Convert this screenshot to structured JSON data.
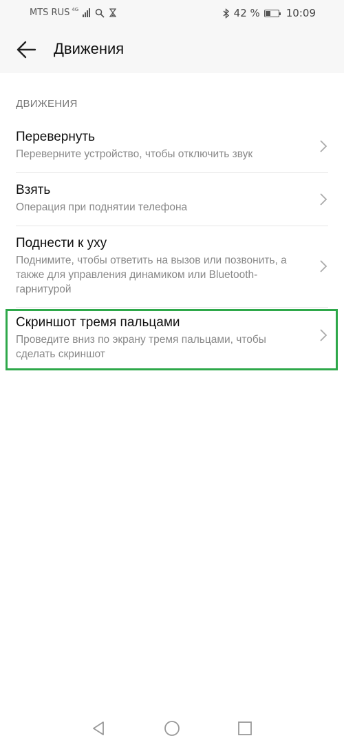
{
  "status_bar": {
    "carrier": "MTS RUS",
    "network_type": "4G",
    "battery_percent": "42 %",
    "battery_level": 0.42,
    "time": "10:09",
    "icons": [
      "signal-icon",
      "search-icon",
      "hourglass-icon",
      "bluetooth-icon",
      "battery-icon"
    ]
  },
  "app_bar": {
    "title": "Движения",
    "back_icon": "arrow-left-icon"
  },
  "section": {
    "header": "ДВИЖЕНИЯ"
  },
  "items": [
    {
      "title": "Перевернуть",
      "subtitle": "Переверните устройство, чтобы отключить звук"
    },
    {
      "title": "Взять",
      "subtitle": "Операция при поднятии телефона"
    },
    {
      "title": "Поднести к уху",
      "subtitle": "Поднимите, чтобы ответить на вызов или позвонить, а также для управления динамиком или Bluetooth-гарнитурой"
    },
    {
      "title": "Скриншот тремя пальцами",
      "subtitle": "Проведите вниз по экрану тремя пальцами, чтобы сделать скриншот"
    }
  ],
  "colors": {
    "highlight": "#2ea84a",
    "bar_background": "#f7f7f7",
    "subtitle_text": "#888888"
  },
  "nav_bar": {
    "icons": [
      "back-triangle-icon",
      "home-circle-icon",
      "recents-square-icon"
    ]
  }
}
